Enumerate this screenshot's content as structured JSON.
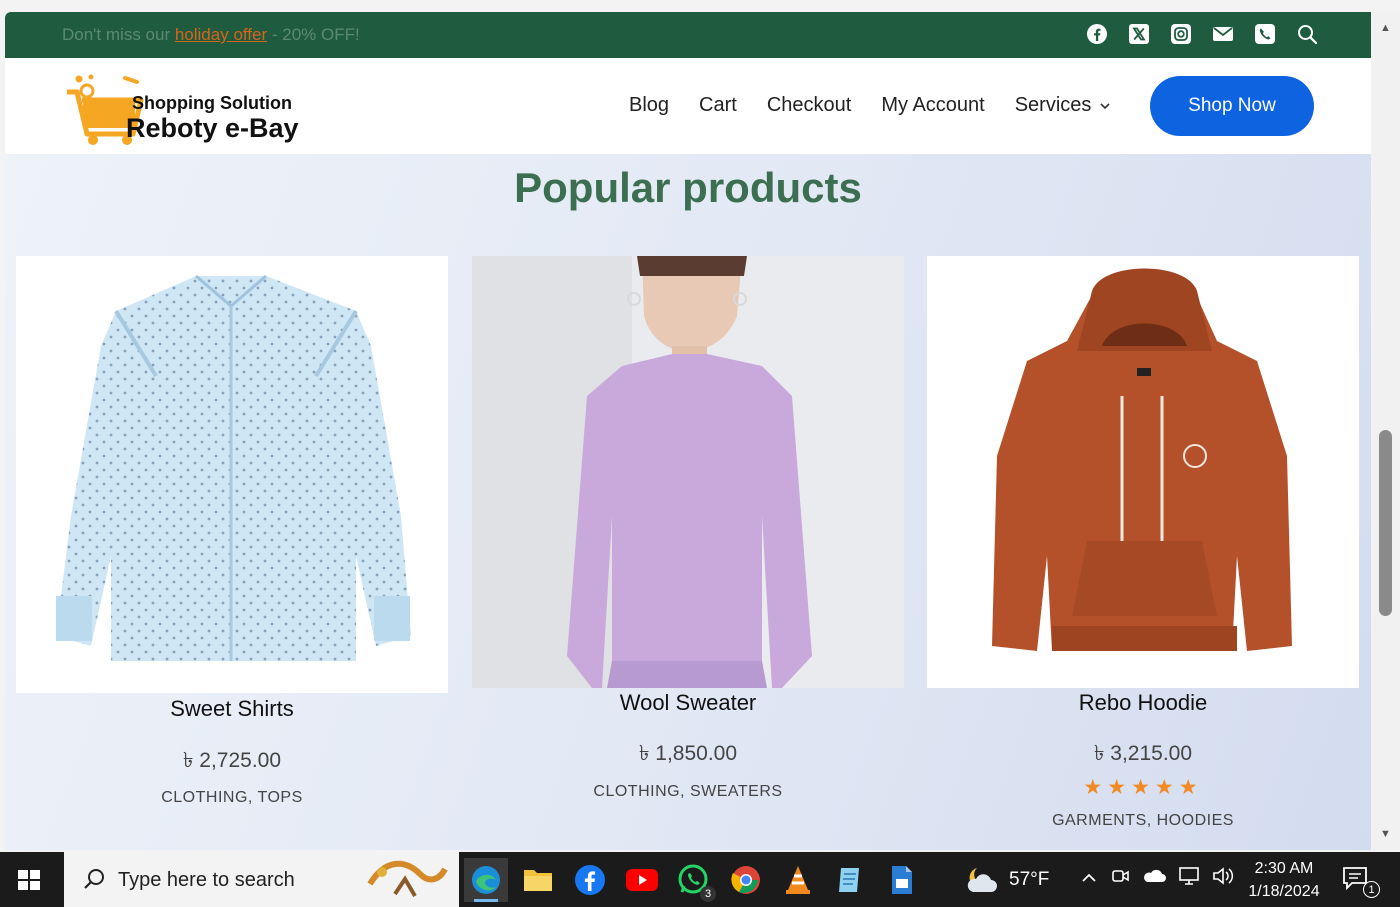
{
  "topbar": {
    "promo_prefix": "Don't miss our ",
    "promo_link": "holiday offer",
    "promo_suffix": " - 20% OFF!",
    "social_icons": [
      "facebook-icon",
      "x-twitter-icon",
      "instagram-icon",
      "email-icon",
      "phone-icon",
      "search-icon"
    ]
  },
  "header": {
    "logo_small": "Shopping Solution",
    "logo_big": "Reboty e-Bay",
    "nav": [
      "Blog",
      "Cart",
      "Checkout",
      "My Account",
      "Services"
    ],
    "cta": "Shop Now"
  },
  "main": {
    "title": "Popular products",
    "products": [
      {
        "name": "Sweet Shirts",
        "price": "৳ 2,725.00",
        "categories": "CLOTHING, TOPS"
      },
      {
        "name": "Wool Sweater",
        "price": "৳ 1,850.00",
        "categories": "CLOTHING, SWEATERS"
      },
      {
        "name": "Rebo Hoodie",
        "price": "৳ 3,215.00",
        "rating": "★★★★★",
        "categories": "GARMENTS, HOODIES"
      }
    ]
  },
  "taskbar": {
    "search_placeholder": "Type here to search",
    "whatsapp_badge": "3",
    "weather_temp": "57°F",
    "time": "2:30 AM",
    "date": "1/18/2024",
    "notifications": "1"
  },
  "colors": {
    "topbar": "#1f5c3f",
    "accent_orange": "#d7641b",
    "title_green": "#3c6e52",
    "button_blue": "#0d63e0",
    "star_orange": "#f08a24"
  }
}
